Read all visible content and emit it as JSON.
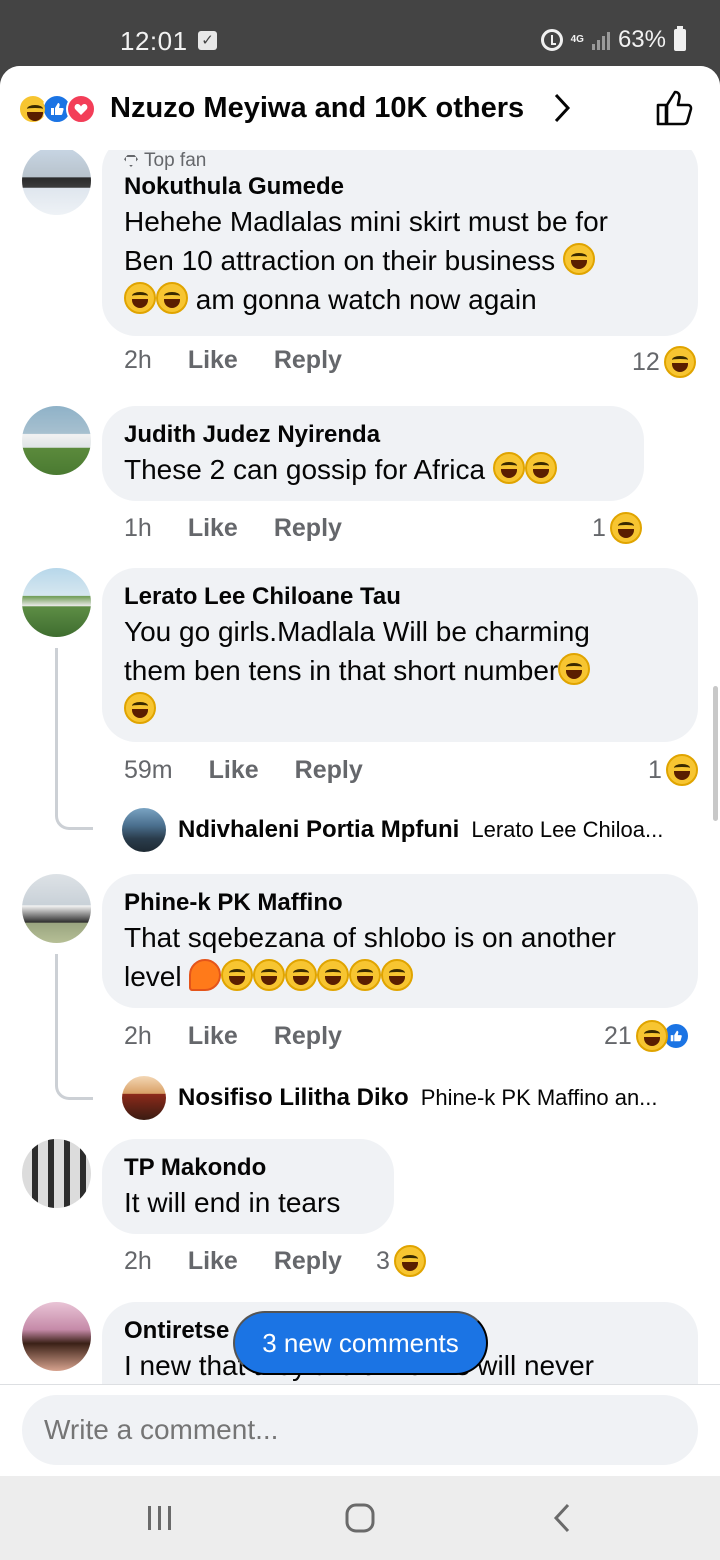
{
  "status": {
    "time": "12:01",
    "network": "4G",
    "battery": "63%"
  },
  "header": {
    "title": "Nzuzo Meyiwa and 10K others"
  },
  "comments": [
    {
      "badge": "Top fan",
      "author": "Nokuthula Gumede",
      "line1": "Hehehe Madlalas mini skirt must be for",
      "line2": "Ben 10 attraction on their business",
      "line3": "am gonna watch now again",
      "time": "2h",
      "like": "Like",
      "reply": "Reply",
      "count": "12"
    },
    {
      "author": "Judith Judez Nyirenda",
      "line1": "These 2 can gossip for Africa",
      "time": "1h",
      "like": "Like",
      "reply": "Reply",
      "count": "1"
    },
    {
      "author": "Lerato Lee Chiloane Tau",
      "line1": "You go girls.Madlala Will be charming",
      "line2": "them ben tens in that short number",
      "time": "59m",
      "like": "Like",
      "reply": "Reply",
      "count": "1",
      "reply_preview": {
        "name": "Ndivhaleni Portia Mpfuni",
        "snippet": "Lerato Lee Chiloa..."
      }
    },
    {
      "author": "Phine-k PK Maffino",
      "line1": "That sqebezana of shlobo is on another",
      "line2": "level",
      "time": "2h",
      "like": "Like",
      "reply": "Reply",
      "count": "21",
      "reply_preview": {
        "name": "Nosifiso Lilitha Diko",
        "snippet": "Phine-k PK Maffino an..."
      }
    },
    {
      "author": "TP Makondo",
      "line1": "It will end in tears",
      "time": "2h",
      "like": "Like",
      "reply": "Reply",
      "count": "3"
    },
    {
      "author": "Ontiretse",
      "line1": "I new that they are uniforms will never"
    }
  ],
  "new_comments": "3 new comments",
  "compose": {
    "placeholder": "Write a comment..."
  },
  "colors": {
    "accent": "#1b74e4",
    "bubble": "#f0f2f5",
    "muted": "#65676b"
  }
}
